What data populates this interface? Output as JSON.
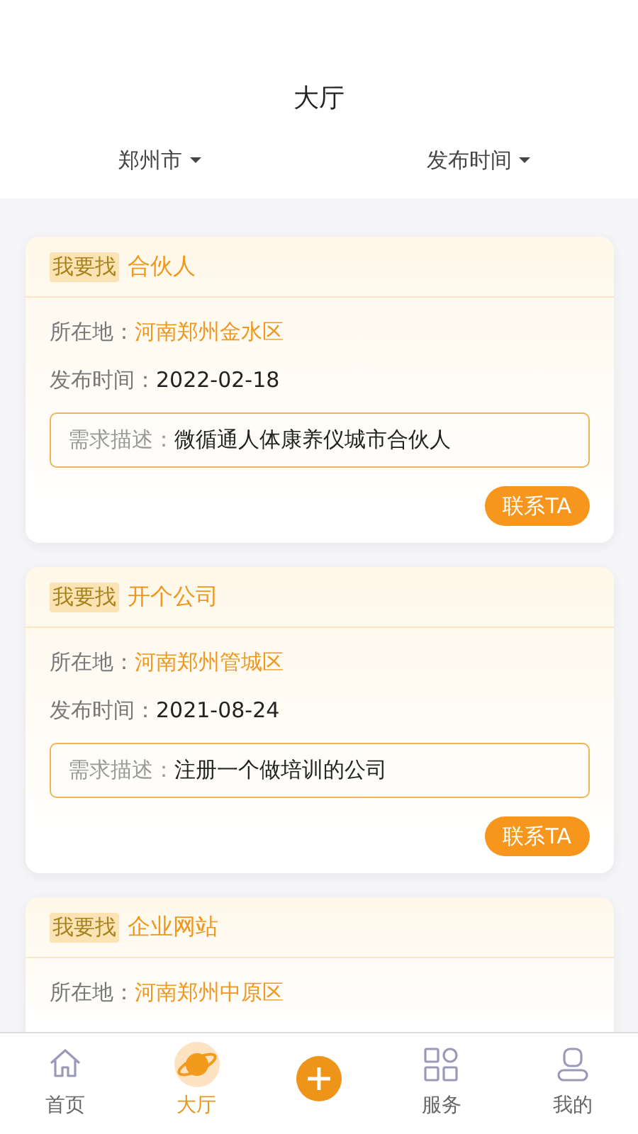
{
  "header": {
    "title": "大厅"
  },
  "filters": [
    {
      "label": "郑州市"
    },
    {
      "label": "发布时间"
    }
  ],
  "cards": [
    {
      "tag": "我要找",
      "title": "合伙人",
      "location_label": "所在地：",
      "location": "河南郑州金水区",
      "date_label": "发布时间：",
      "date": "2022-02-18",
      "desc_label": "需求描述：",
      "desc": "微循通人体康养仪城市合伙人",
      "button": "联系TA"
    },
    {
      "tag": "我要找",
      "title": "开个公司",
      "location_label": "所在地：",
      "location": "河南郑州管城区",
      "date_label": "发布时间：",
      "date": "2021-08-24",
      "desc_label": "需求描述：",
      "desc": "注册一个做培训的公司",
      "button": "联系TA"
    },
    {
      "tag": "我要找",
      "title": "企业网站",
      "location_label": "所在地：",
      "location": "河南郑州中原区"
    }
  ],
  "tabbar": [
    {
      "kind": "home",
      "label": "首页",
      "selected": false
    },
    {
      "kind": "planet",
      "label": "大厅",
      "selected": true
    },
    {
      "kind": "add"
    },
    {
      "kind": "grid",
      "label": "服务",
      "selected": false
    },
    {
      "kind": "user",
      "label": "我的",
      "selected": false
    }
  ]
}
